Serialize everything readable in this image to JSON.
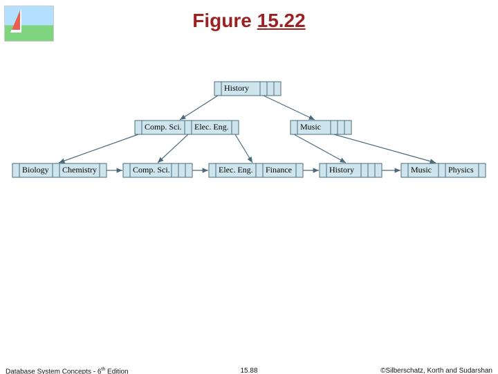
{
  "title_prefix": "Figure ",
  "title_number": "15.22",
  "tree": {
    "root": {
      "label": "History"
    },
    "level2": [
      {
        "label": "Comp. Sci."
      },
      {
        "label": "Elec. Eng."
      },
      {
        "label": "Music"
      }
    ],
    "leaves": [
      {
        "label": "Biology"
      },
      {
        "label": "Chemistry"
      },
      {
        "label": "Comp. Sci."
      },
      {
        "label": "Elec. Eng."
      },
      {
        "label": "Finance"
      },
      {
        "label": "History"
      },
      {
        "label": "Music"
      },
      {
        "label": "Physics"
      }
    ]
  },
  "footer": {
    "left_prefix": "Database System Concepts - 6",
    "left_sup": "th",
    "left_suffix": " Edition",
    "center": "15.88",
    "right": "©Silberschatz, Korth and Sudarshan"
  },
  "colors": {
    "title": "#9b2222",
    "node_fill": "#cfe5ee",
    "node_stroke": "#4a6a7a"
  }
}
